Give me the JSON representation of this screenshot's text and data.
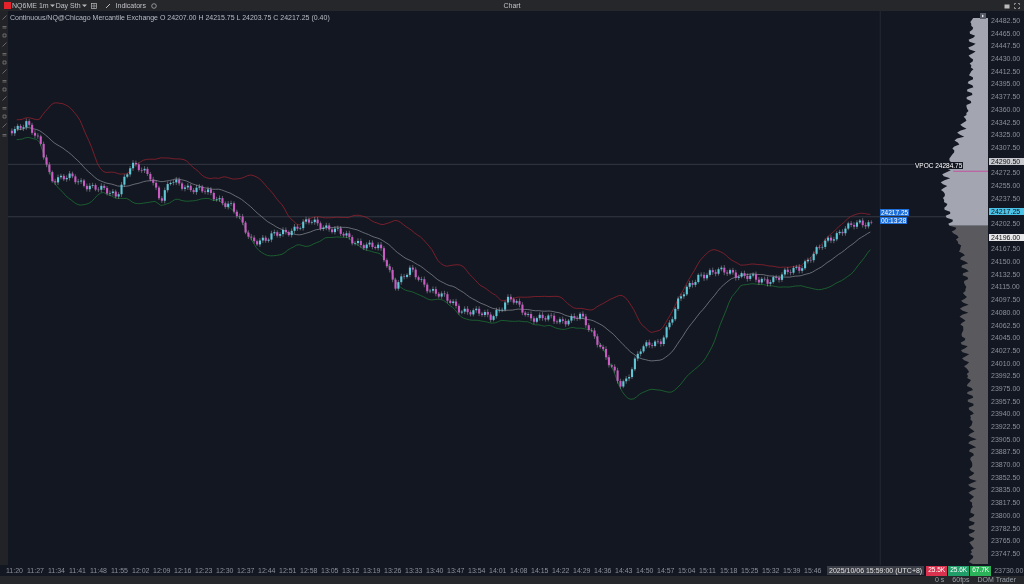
{
  "window": {
    "title": "Chart"
  },
  "toolbar": {
    "symbol": "NQ6ME",
    "interval": "1m",
    "session": "Day Sth",
    "indicators": "Indicators"
  },
  "legend": "Continuous/NQ@Chicago Mercantile Exchange O 24207.00 H 24215.75 L 24203.75 C 24217.25 (0.40)",
  "price_axis": [
    {
      "kind": "label",
      "text": "24482.50"
    },
    {
      "kind": "label",
      "text": "24465.00"
    },
    {
      "kind": "label",
      "text": "24447.50"
    },
    {
      "kind": "label",
      "text": "24430.00"
    },
    {
      "kind": "label",
      "text": "24412.50"
    },
    {
      "kind": "label",
      "text": "24395.00"
    },
    {
      "kind": "label",
      "text": "24377.50"
    },
    {
      "kind": "label",
      "text": "24360.00"
    },
    {
      "kind": "label",
      "text": "24342.50"
    },
    {
      "kind": "label",
      "text": "24325.00"
    },
    {
      "kind": "label",
      "text": "24307.50"
    },
    {
      "kind": "level",
      "text": "24290.50"
    },
    {
      "kind": "label",
      "text": "24272.50"
    },
    {
      "kind": "label",
      "text": "24255.00"
    },
    {
      "kind": "label",
      "text": "24237.50"
    },
    {
      "kind": "last",
      "text": "24217.25"
    },
    {
      "kind": "label",
      "text": "24202.50"
    },
    {
      "kind": "cursor",
      "text": "24196.00"
    },
    {
      "kind": "label",
      "text": "24167.50"
    },
    {
      "kind": "label",
      "text": "24150.00"
    },
    {
      "kind": "label",
      "text": "24132.50"
    },
    {
      "kind": "label",
      "text": "24115.00"
    },
    {
      "kind": "label",
      "text": "24097.50"
    },
    {
      "kind": "label",
      "text": "24080.00"
    },
    {
      "kind": "label",
      "text": "24062.50"
    },
    {
      "kind": "label",
      "text": "24045.00"
    },
    {
      "kind": "label",
      "text": "24027.50"
    },
    {
      "kind": "label",
      "text": "24010.00"
    },
    {
      "kind": "label",
      "text": "23992.50"
    },
    {
      "kind": "label",
      "text": "23975.00"
    },
    {
      "kind": "label",
      "text": "23957.50"
    },
    {
      "kind": "label",
      "text": "23940.00"
    },
    {
      "kind": "label",
      "text": "23922.50"
    },
    {
      "kind": "label",
      "text": "23905.00"
    },
    {
      "kind": "label",
      "text": "23887.50"
    },
    {
      "kind": "label",
      "text": "23870.00"
    },
    {
      "kind": "label",
      "text": "23852.50"
    },
    {
      "kind": "label",
      "text": "23835.00"
    },
    {
      "kind": "label",
      "text": "23817.50"
    },
    {
      "kind": "label",
      "text": "23800.00"
    },
    {
      "kind": "label",
      "text": "23782.50"
    },
    {
      "kind": "label",
      "text": "23765.00"
    },
    {
      "kind": "label",
      "text": "23747.50"
    }
  ],
  "poc_label": "VPOC 24284.75",
  "last_price_tag": {
    "price": "24217.25",
    "countdown": "00:13:28"
  },
  "time_axis": [
    "11:20",
    "11:27",
    "11:34",
    "11:41",
    "11:48",
    "11:55",
    "12:02",
    "12:09",
    "12:16",
    "12:23",
    "12:30",
    "12:37",
    "12:44",
    "12:51",
    "12:58",
    "13:05",
    "13:12",
    "13:19",
    "13:26",
    "13:33",
    "13:40",
    "13:47",
    "13:54",
    "14:01",
    "14:08",
    "14:15",
    "14:22",
    "14:29",
    "14:36",
    "14:43",
    "14:50",
    "14:57",
    "15:04",
    "15:11",
    "15:18",
    "15:25",
    "15:32",
    "15:39",
    "15:46"
  ],
  "cursor_time": "2025/10/06 15:59:00 (UTC+8)",
  "volume_pills": [
    {
      "text": "25.5K",
      "color": "#d8324e"
    },
    {
      "text": "25.6K",
      "color": "#1f9e6a"
    },
    {
      "text": "67.7K",
      "color": "#2bb35a"
    }
  ],
  "corner_price": "23730.00",
  "status_bar": [
    "0 s",
    "60fps",
    "DOM Trader"
  ]
}
